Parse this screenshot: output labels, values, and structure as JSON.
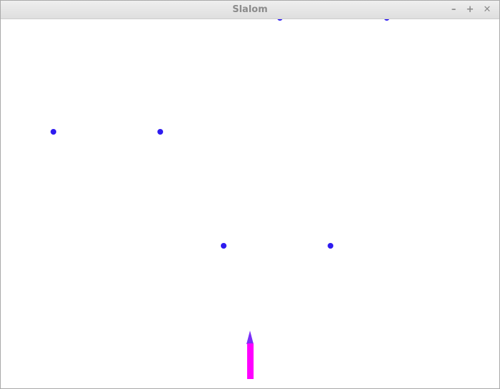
{
  "window": {
    "title": "Slalom",
    "controls": {
      "minimize": "–",
      "maximize": "+",
      "close": "✕"
    }
  },
  "colors": {
    "gate_flag": "#2e1bf0",
    "skier_body": "#ff00ff",
    "skier_tip": "#7b2ff7"
  },
  "gates": [
    {
      "name": "gate-1-left"
    },
    {
      "name": "gate-1-right"
    },
    {
      "name": "gate-2-left"
    },
    {
      "name": "gate-2-right"
    },
    {
      "name": "gate-3-left"
    },
    {
      "name": "gate-3-right"
    }
  ]
}
